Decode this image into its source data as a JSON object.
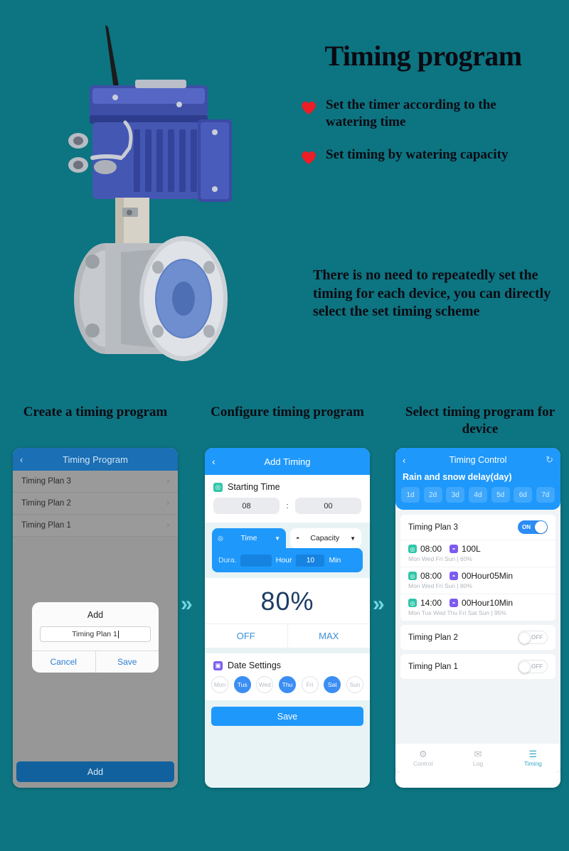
{
  "theme": {
    "background": "#0d7481",
    "accent_blue": "#1e98fb",
    "heart_red": "#ee1c24",
    "arrow": "#6fd8e0"
  },
  "hero": {
    "title": "Timing program",
    "bullets": [
      {
        "icon": "heart-icon",
        "text": "Set the timer according to the watering time"
      },
      {
        "icon": "heart-icon",
        "text": "Set timing by watering capacity"
      }
    ],
    "note": "There is no need to repeatedly set the timing for each device, you can directly select the set timing scheme",
    "product_image_alt": "electric-ball-valve-actuator"
  },
  "sections": [
    {
      "heading": "Create a timing program"
    },
    {
      "heading": "Configure timing program"
    },
    {
      "heading": "Select timing program for device"
    }
  ],
  "arrows": {
    "glyph": "»"
  },
  "phone1": {
    "nav": {
      "back_icon": "‹",
      "title": "Timing Program"
    },
    "plans": [
      {
        "label": "Timing Plan 3",
        "chevron": "›"
      },
      {
        "label": "Timing Plan 2",
        "chevron": "›"
      },
      {
        "label": "Timing Plan 1",
        "chevron": "›"
      }
    ],
    "modal": {
      "title": "Add",
      "input_value": "Timing Plan 1",
      "input_placeholder": "Timing Plan 1",
      "cancel_label": "Cancel",
      "save_label": "Save"
    },
    "add_button": "Add"
  },
  "phone2": {
    "nav": {
      "back_icon": "‹",
      "title": "Add Timing"
    },
    "start_time": {
      "label": "Starting Time",
      "icon": "clock-icon",
      "hour": "08",
      "minute": "00",
      "separator": ":"
    },
    "mode_tabs": [
      {
        "label": "Time",
        "icon": "clock-icon",
        "chevron": "▼",
        "active": true
      },
      {
        "label": "Capacity",
        "icon": "drop-icon",
        "chevron": "▼",
        "active": false
      }
    ],
    "duration": {
      "label": "Dura.",
      "hour_value": "",
      "hour_unit": "Hour",
      "minute_value": "10",
      "minute_unit": "Min"
    },
    "percent": "80%",
    "percent_buttons": [
      "OFF",
      "MAX"
    ],
    "date_settings": {
      "label": "Date Settings",
      "icon": "calendar-icon",
      "days": [
        {
          "label": "Mon",
          "selected": false
        },
        {
          "label": "Tus",
          "selected": true
        },
        {
          "label": "Wed",
          "selected": false
        },
        {
          "label": "Thu",
          "selected": true
        },
        {
          "label": "Fri",
          "selected": false
        },
        {
          "label": "Sat",
          "selected": true
        },
        {
          "label": "Sun",
          "selected": false
        }
      ]
    },
    "save_button": "Save"
  },
  "phone3": {
    "nav": {
      "back_icon": "‹",
      "title": "Timing Control",
      "refresh_icon": "↻"
    },
    "delay": {
      "label": "Rain and snow delay(day)",
      "options": [
        "1d",
        "2d",
        "3d",
        "4d",
        "5d",
        "6d",
        "7d"
      ]
    },
    "plans": [
      {
        "name": "Timing Plan 3",
        "toggle_label": "ON",
        "toggle_on": true,
        "schedules": [
          {
            "time": "08:00",
            "amount": "100L",
            "days": "Mon  Wed  Fri  Sun  |  60%"
          },
          {
            "time": "08:00",
            "amount": "00Hour05Min",
            "days": "Mon  Wed  Fri  Sun  |  80%"
          },
          {
            "time": "14:00",
            "amount": "00Hour10Min",
            "days": "Mon  Tus  Wed  Thu  Fri  Sat  Sun  |  95%"
          }
        ]
      },
      {
        "name": "Timing Plan 2",
        "toggle_label": "OFF",
        "toggle_on": false,
        "schedules": []
      },
      {
        "name": "Timing Plan 1",
        "toggle_label": "OFF",
        "toggle_on": false,
        "schedules": []
      }
    ],
    "tabs": [
      {
        "label": "Control",
        "icon": "gear-icon",
        "glyph": "⚙",
        "selected": false
      },
      {
        "label": "Log",
        "icon": "mail-icon",
        "glyph": "✉",
        "selected": false
      },
      {
        "label": "Timing",
        "icon": "list-icon",
        "glyph": "☰",
        "selected": true
      }
    ]
  }
}
